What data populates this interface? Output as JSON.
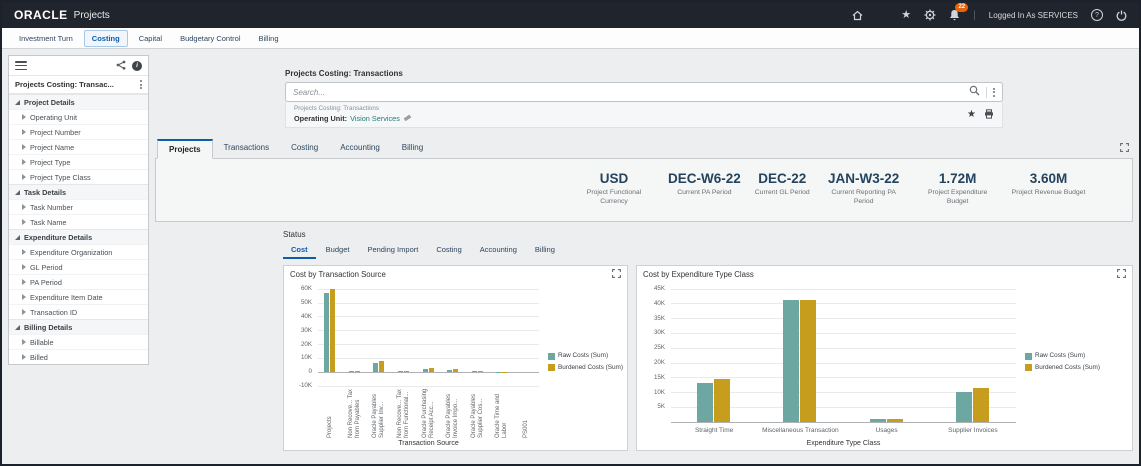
{
  "app": {
    "brand": "ORACLE",
    "product": "Projects",
    "notification_count": "22",
    "logged_in_text": "Logged In As SERVICES"
  },
  "nav_tabs": [
    {
      "label": "Investment Turn",
      "active": false
    },
    {
      "label": "Costing",
      "active": true
    },
    {
      "label": "Capital",
      "active": false
    },
    {
      "label": "Budgetary Control",
      "active": false
    },
    {
      "label": "Billing",
      "active": false
    }
  ],
  "sidebar": {
    "title": "Projects Costing: Transac...",
    "sections": [
      {
        "label": "Project Details",
        "items": [
          "Operating Unit",
          "Project Number",
          "Project Name",
          "Project Type",
          "Project Type Class"
        ]
      },
      {
        "label": "Task Details",
        "items": [
          "Task Number",
          "Task Name"
        ]
      },
      {
        "label": "Expenditure Details",
        "items": [
          "Expenditure Organization",
          "GL Period",
          "PA Period",
          "Expenditure Item Date",
          "Transaction ID"
        ]
      },
      {
        "label": "Billing Details",
        "items": [
          "Billable",
          "Billed"
        ]
      }
    ]
  },
  "search": {
    "title": "Projects Costing: Transactions",
    "placeholder": "Search...",
    "saved_context": "Projects Costing: Transactions",
    "filter_name": "Operating Unit:",
    "filter_value": "Vision Services"
  },
  "main_tabs": [
    {
      "label": "Projects",
      "active": true
    },
    {
      "label": "Transactions",
      "active": false
    },
    {
      "label": "Costing",
      "active": false
    },
    {
      "label": "Accounting",
      "active": false
    },
    {
      "label": "Billing",
      "active": false
    }
  ],
  "kpis": [
    {
      "value": "USD",
      "label": "Project Functional Currency"
    },
    {
      "value": "DEC-W6-22",
      "label": "Current PA Period"
    },
    {
      "value": "DEC-22",
      "label": "Current GL Period"
    },
    {
      "value": "JAN-W3-22",
      "label": "Current Reporting PA Period"
    },
    {
      "value": "1.72M",
      "label": "Project Expenditure Budget"
    },
    {
      "value": "3.60M",
      "label": "Project Revenue Budget"
    }
  ],
  "status_label": "Status",
  "sub_tabs": [
    {
      "label": "Cost",
      "active": true
    },
    {
      "label": "Budget",
      "active": false
    },
    {
      "label": "Pending Import",
      "active": false
    },
    {
      "label": "Costing",
      "active": false
    },
    {
      "label": "Accounting",
      "active": false
    },
    {
      "label": "Billing",
      "active": false
    }
  ],
  "colors": {
    "raw_costs": "#6da7a1",
    "burdened_costs": "#c79d1e",
    "accent": "#0b5cab"
  },
  "chart_data": [
    {
      "type": "bar",
      "title": "Cost by Transaction Source",
      "xlabel": "Transaction Source",
      "ylabel": "",
      "ylim": [
        -10000,
        60000
      ],
      "grid": true,
      "legend_position": "right",
      "yticks": [
        {
          "v": 60000,
          "label": "60K"
        },
        {
          "v": 50000,
          "label": "50K"
        },
        {
          "v": 40000,
          "label": "40K"
        },
        {
          "v": 30000,
          "label": "30K"
        },
        {
          "v": 20000,
          "label": "20K"
        },
        {
          "v": 10000,
          "label": "10K"
        },
        {
          "v": 0,
          "label": "0"
        },
        {
          "v": -10000,
          "label": "-10K"
        }
      ],
      "categories": [
        "Projects",
        "Non Recove... Tax from Payables",
        "Oracle Payables Supplier Inv...",
        "Non Recove... Tax from Functional...",
        "Oracle Purchasing Receipt Acc...",
        "Oracle Payables Invoice Impo...",
        "Oracle Payables Supplier Cos...",
        "Oracle Time and Labor",
        "PS001"
      ],
      "series": [
        {
          "name": "Raw Costs (Sum)",
          "color": "#6da7a1",
          "values": [
            57000,
            600,
            6000,
            300,
            2200,
            1500,
            700,
            150,
            0
          ]
        },
        {
          "name": "Burdened Costs (Sum)",
          "color": "#c79d1e",
          "values": [
            60000,
            800,
            7500,
            400,
            2600,
            1800,
            900,
            200,
            0
          ]
        }
      ]
    },
    {
      "type": "bar",
      "title": "Cost by Expenditure Type Class",
      "xlabel": "Expenditure Type Class",
      "ylabel": "",
      "ylim": [
        0,
        45000
      ],
      "grid": true,
      "legend_position": "right",
      "yticks": [
        {
          "v": 45000,
          "label": "45K"
        },
        {
          "v": 40000,
          "label": "40K"
        },
        {
          "v": 35000,
          "label": "35K"
        },
        {
          "v": 30000,
          "label": "30K"
        },
        {
          "v": 25000,
          "label": "25K"
        },
        {
          "v": 20000,
          "label": "20K"
        },
        {
          "v": 15000,
          "label": "15K"
        },
        {
          "v": 10000,
          "label": "10K"
        },
        {
          "v": 5000,
          "label": "5K"
        }
      ],
      "categories": [
        "Straight Time",
        "Miscellaneous Transaction",
        "Usages",
        "Supplier Invoices"
      ],
      "series": [
        {
          "name": "Raw Costs (Sum)",
          "color": "#6da7a1",
          "values": [
            13000,
            41000,
            1000,
            10000
          ]
        },
        {
          "name": "Burdened Costs (Sum)",
          "color": "#c79d1e",
          "values": [
            14500,
            41000,
            1000,
            11500
          ]
        }
      ]
    }
  ]
}
